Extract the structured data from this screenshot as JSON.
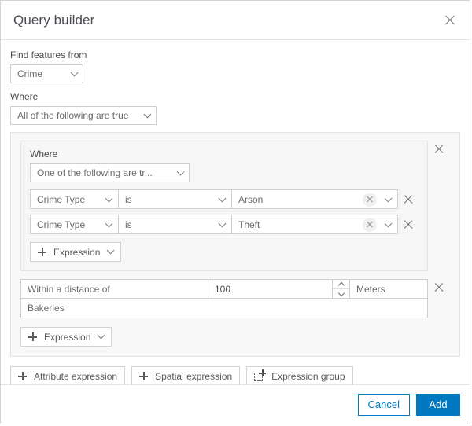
{
  "dialog": {
    "title": "Query builder",
    "close_icon": "close-icon"
  },
  "find_features": {
    "label": "Find features from",
    "layer": "Crime"
  },
  "where_root": {
    "label": "Where",
    "operator": "All of the following are true"
  },
  "group": {
    "label": "Where",
    "operator": "One of the following are tr...",
    "expressions": [
      {
        "field": "Crime Type",
        "operator": "is",
        "value": "Arson"
      },
      {
        "field": "Crime Type",
        "operator": "is",
        "value": "Theft"
      }
    ],
    "add_expression_label": "Expression"
  },
  "spatial": {
    "relationship": "Within a distance of",
    "distance": "100",
    "unit": "Meters",
    "target_layer": "Bakeries"
  },
  "root_add_expression_label": "Expression",
  "add_bar": {
    "attribute_expression": "Attribute expression",
    "spatial_expression": "Spatial expression",
    "expression_group": "Expression group"
  },
  "footer": {
    "cancel": "Cancel",
    "add": "Add"
  },
  "colors": {
    "accent": "#0079c1",
    "panel": "#f8f8f8",
    "border": "#cfcfcf",
    "text": "#4c4c4c"
  }
}
